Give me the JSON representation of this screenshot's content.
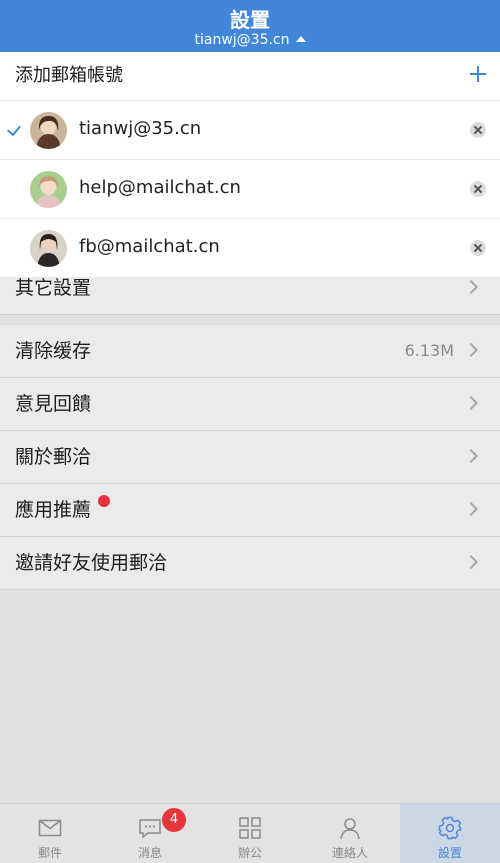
{
  "header": {
    "title": "設置",
    "account": "tianwj@35.cn"
  },
  "dropdown": {
    "add_label": "添加郵箱帳號",
    "accounts": [
      {
        "email": "tianwj@35.cn",
        "selected": true
      },
      {
        "email": "help@mailchat.cn",
        "selected": false
      },
      {
        "email": "fb@mailchat.cn",
        "selected": false
      }
    ]
  },
  "settings": {
    "other_label": "其它設置",
    "clear_cache_label": "清除缓存",
    "cache_size": "6.13M",
    "feedback_label": "意見回饋",
    "about_label": "關於郵洽",
    "apps_label": "應用推薦",
    "invite_label": "邀請好友使用郵洽"
  },
  "tabs": [
    {
      "label": "郵件",
      "icon": "mail-icon"
    },
    {
      "label": "消息",
      "icon": "chat-icon",
      "badge": "4"
    },
    {
      "label": "辦公",
      "icon": "grid-icon"
    },
    {
      "label": "連絡人",
      "icon": "person-icon"
    },
    {
      "label": "設置",
      "icon": "gear-icon",
      "active": true
    }
  ],
  "colors": {
    "accent": "#4286d9",
    "badge": "#e7353e"
  }
}
